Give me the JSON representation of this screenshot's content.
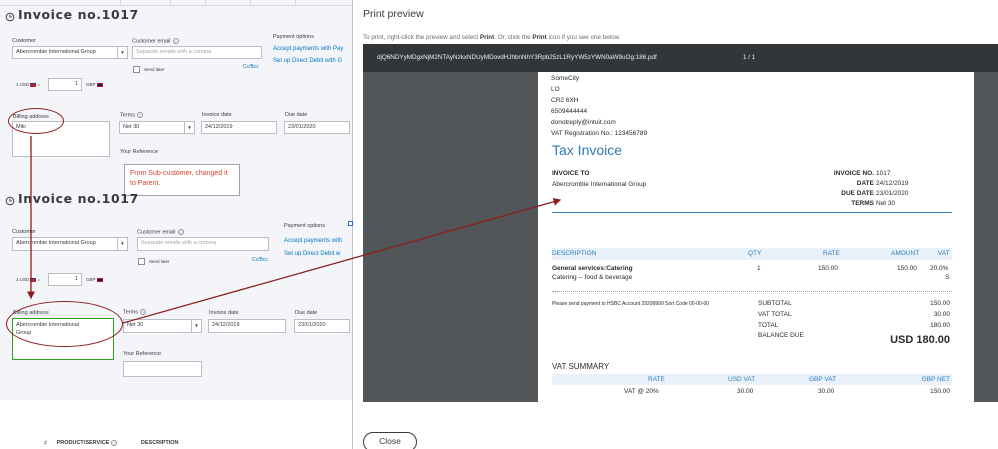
{
  "left_panel": {
    "top_form": {
      "title": "Invoice no.1017",
      "customer_label": "Customer",
      "customer_value": "Abercrombie International Group",
      "email_label": "Customer email",
      "email_placeholder": "Separate emails with a comma",
      "send_later_label": "Send later",
      "cc_bcc": "Cc/Bcc",
      "payment_options_label": "Payment options",
      "accept_payments": "Accept payments with Pay",
      "setup_direct_debit": "Set up Direct Debit with G",
      "rate_prefix": "1 USD",
      "rate_eq": "=",
      "rate_value": "1",
      "rate_suffix": "GBP",
      "billing_label": "Billing address",
      "billing_value": "Miki",
      "terms_label": "Terms",
      "terms_value": "Net 30",
      "invoice_date_label": "Invoice date",
      "invoice_date_value": "24/12/2019",
      "due_date_label": "Due date",
      "due_date_value": "23/01/2020",
      "your_reference_label": "Your Reference"
    },
    "note": "From Sub-customer, changed it to Parent.",
    "bottom_form": {
      "title": "Invoice no.1017",
      "customer_label": "Customer",
      "customer_value": "Abercrombie International Group",
      "email_label": "Customer email",
      "email_placeholder": "Separate emails with a comma",
      "send_later_label": "Send later",
      "cc_bcc": "Cc/Bcc",
      "payment_options_label": "Payment options",
      "accept_payments": "Accept payments with",
      "setup_direct_debit": "Set up Direct Debit w",
      "rate_prefix": "1 USD",
      "rate_eq": "=",
      "rate_value": "1",
      "rate_suffix": "GBP",
      "billing_label": "Billing address",
      "billing_line1": "Abercrombie International",
      "billing_line2": "Group",
      "terms_label": "Terms",
      "terms_value": "Net 30",
      "invoice_date_label": "Invoice date",
      "invoice_date_value": "24/12/2019",
      "due_date_label": "Due date",
      "due_date_value": "23/01/2020",
      "your_reference_label": "Your Reference"
    },
    "table_header": {
      "hash": "#",
      "product_service": "PRODUCT/SERVICE",
      "description": "DESCRIPTION"
    }
  },
  "print_preview": {
    "title": "Print preview",
    "instruction_pre": "To print, right-click the preview and select ",
    "instruction_print1": "Print",
    "instruction_mid": ". Or, click the ",
    "instruction_print2": "Print",
    "instruction_post": " icon if you see one below.",
    "filename": "djQ6NDYyMDgxNjM2NTAyNzkxNDUyMDovdHJhbnNhY3Rpb25zL1RyYW5zYWN0aW9uOg:186.pdf",
    "page_indicator": "1 / 1",
    "close_label": "Close",
    "invoice": {
      "company_lines": [
        "SomeCity",
        "LO",
        "CR2 6XH",
        "6509444444",
        "donotreply@intuit.com",
        "VAT Registration No.: 123456789"
      ],
      "heading": "Tax Invoice",
      "invoice_to_label": "INVOICE TO",
      "invoice_to_value": "Abercrombie International Group",
      "invoice_no_label": "INVOICE NO.",
      "invoice_no_value": "1017",
      "date_label": "DATE",
      "date_value": "24/12/2019",
      "due_date_label": "DUE DATE",
      "due_date_value": "23/01/2020",
      "terms_label": "TERMS",
      "terms_value": "Net 30",
      "columns": {
        "description": "DESCRIPTION",
        "qty": "QTY",
        "rate": "RATE",
        "amount": "AMOUNT",
        "vat": "VAT"
      },
      "line": {
        "name": "General services:Catering",
        "detail": "Catering -- food & beverage",
        "qty": "1",
        "rate": "150.00",
        "amount": "150.00",
        "vat": "20.0%",
        "vat_code": "S"
      },
      "payment_note": "Please send payment to HSBC Account 29299999 Sort Code 00-00-00",
      "subtotal_label": "SUBTOTAL",
      "subtotal_value": "150.00",
      "vat_total_label": "VAT TOTAL",
      "vat_total_value": "30.00",
      "total_label": "TOTAL",
      "total_value": "180.00",
      "balance_due_label": "BALANCE DUE",
      "balance_due_value": "USD 180.00",
      "vat_summary_title": "VAT SUMMARY",
      "vat_summary_columns": {
        "rate": "RATE",
        "usd_vat": "USD VAT",
        "gbp_vat": "GBP VAT",
        "gbp_net": "GBP NET"
      },
      "vat_summary_row": {
        "rate": "VAT @ 20%",
        "usd_vat": "30.00",
        "gbp_vat": "30.00",
        "gbp_net": "150.00"
      }
    }
  },
  "colors": {
    "annotation": "#8b1d1d",
    "note_text": "#e3402d",
    "link": "#0077c5",
    "invoice_accent": "#2e7bb8",
    "viewer_bg": "#525659",
    "viewer_toolbar": "#323639"
  }
}
